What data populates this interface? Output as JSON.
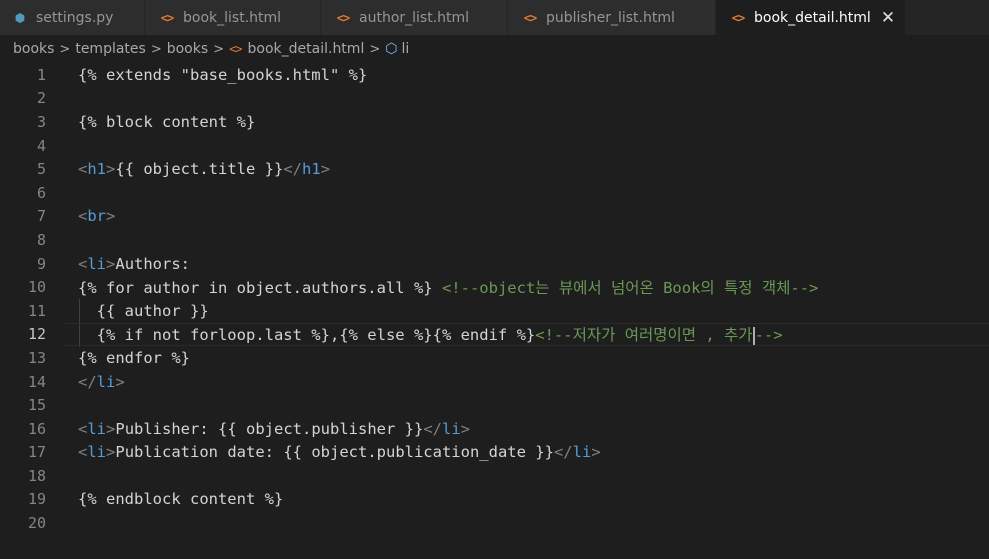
{
  "tabs": [
    {
      "label": "settings.py",
      "icon": "python-icon",
      "active": false
    },
    {
      "label": "book_list.html",
      "icon": "html-icon",
      "active": false
    },
    {
      "label": "author_list.html",
      "icon": "html-icon",
      "active": false
    },
    {
      "label": "publisher_list.html",
      "icon": "html-icon",
      "active": false
    },
    {
      "label": "book_detail.html",
      "icon": "html-icon",
      "active": true,
      "close": "✕"
    }
  ],
  "breadcrumb": {
    "items": [
      "books",
      "templates",
      "books",
      "book_detail.html",
      "li"
    ],
    "separator": ">"
  },
  "editor": {
    "current_line": 12,
    "lines": [
      {
        "num": "1",
        "code": [
          {
            "t": "{% extends \"base_books.html\" %}",
            "c": "txt"
          }
        ]
      },
      {
        "num": "2",
        "code": []
      },
      {
        "num": "3",
        "code": [
          {
            "t": "{% block content %}",
            "c": "txt"
          }
        ]
      },
      {
        "num": "4",
        "code": []
      },
      {
        "num": "5",
        "code": [
          {
            "t": "<",
            "c": "tag"
          },
          {
            "t": "h1",
            "c": "name"
          },
          {
            "t": ">",
            "c": "tag"
          },
          {
            "t": "{{ object.title }}",
            "c": "txt"
          },
          {
            "t": "</",
            "c": "tag"
          },
          {
            "t": "h1",
            "c": "name"
          },
          {
            "t": ">",
            "c": "tag"
          }
        ]
      },
      {
        "num": "6",
        "code": []
      },
      {
        "num": "7",
        "code": [
          {
            "t": "<",
            "c": "tag"
          },
          {
            "t": "br",
            "c": "name"
          },
          {
            "t": ">",
            "c": "tag"
          }
        ]
      },
      {
        "num": "8",
        "code": []
      },
      {
        "num": "9",
        "code": [
          {
            "t": "<",
            "c": "tag"
          },
          {
            "t": "li",
            "c": "name"
          },
          {
            "t": ">",
            "c": "tag"
          },
          {
            "t": "Authors:",
            "c": "txt"
          }
        ]
      },
      {
        "num": "10",
        "code": [
          {
            "t": "{% for author in object.authors.all %} ",
            "c": "txt"
          },
          {
            "t": "<!--object는 뷰에서 넘어온 Book의 특정 객체-->",
            "c": "cmt"
          }
        ]
      },
      {
        "num": "11",
        "code": [
          {
            "t": "  {{ author }}",
            "c": "txt"
          }
        ]
      },
      {
        "num": "12",
        "code": [
          {
            "t": "  {% if not forloop.last %},{% else %}{% endif %}",
            "c": "txt"
          },
          {
            "t": "<!--저자가 여러명이면 , 추가",
            "c": "cmt"
          },
          {
            "t": "CURSOR",
            "c": "cursor"
          },
          {
            "t": "-->",
            "c": "cmt"
          }
        ]
      },
      {
        "num": "13",
        "code": [
          {
            "t": "{% endfor %}",
            "c": "txt"
          }
        ]
      },
      {
        "num": "14",
        "code": [
          {
            "t": "</",
            "c": "tag"
          },
          {
            "t": "li",
            "c": "name"
          },
          {
            "t": ">",
            "c": "tag"
          }
        ]
      },
      {
        "num": "15",
        "code": []
      },
      {
        "num": "16",
        "code": [
          {
            "t": "<",
            "c": "tag"
          },
          {
            "t": "li",
            "c": "name"
          },
          {
            "t": ">",
            "c": "tag"
          },
          {
            "t": "Publisher: {{ object.publisher }}",
            "c": "txt"
          },
          {
            "t": "</",
            "c": "tag"
          },
          {
            "t": "li",
            "c": "name"
          },
          {
            "t": ">",
            "c": "tag"
          }
        ]
      },
      {
        "num": "17",
        "code": [
          {
            "t": "<",
            "c": "tag"
          },
          {
            "t": "li",
            "c": "name"
          },
          {
            "t": ">",
            "c": "tag"
          },
          {
            "t": "Publication date: {{ object.publication_date }}",
            "c": "txt"
          },
          {
            "t": "</",
            "c": "tag"
          },
          {
            "t": "li",
            "c": "name"
          },
          {
            "t": ">",
            "c": "tag"
          }
        ]
      },
      {
        "num": "18",
        "code": []
      },
      {
        "num": "19",
        "code": [
          {
            "t": "{% endblock content %}",
            "c": "txt"
          }
        ]
      },
      {
        "num": "20",
        "code": []
      }
    ]
  },
  "colors": {
    "background": "#1e1e1e",
    "tabbar": "#252526",
    "html_icon": "#e37933",
    "python_icon": "#519aba",
    "tag_bracket": "#808080",
    "tag_name": "#569cd6",
    "comment": "#6a9955"
  }
}
